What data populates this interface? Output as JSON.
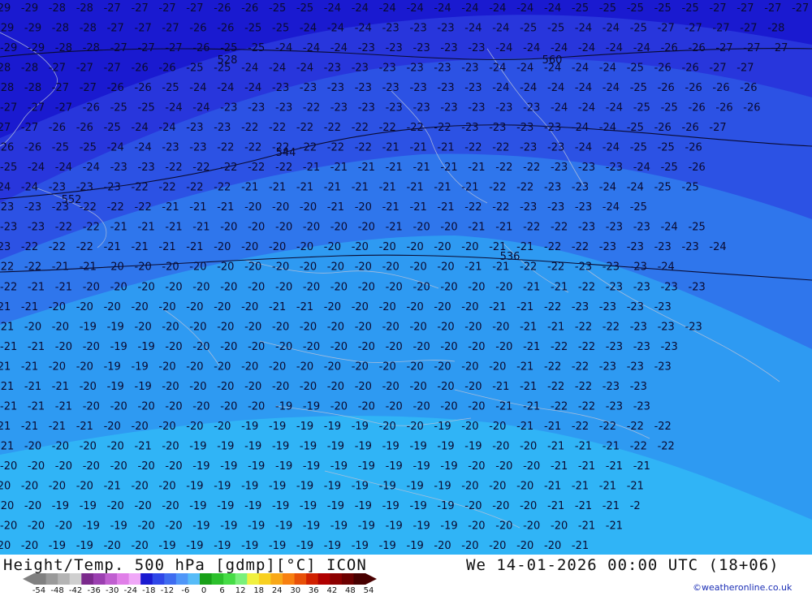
{
  "map": {
    "title": "Height/Temp. 500 hPa [gdmp][°C] ICON",
    "valid_time": "We 14-01-2026 00:00 UTC (18+06)",
    "credit": "©weatheronline.co.uk",
    "height_labels": [
      "560",
      "552",
      "544",
      "536",
      "528"
    ],
    "temperature_rows": [
      {
        "values": [
          29,
          29,
          28,
          28,
          27,
          27,
          27,
          27,
          26,
          26,
          25,
          25,
          24,
          24,
          24,
          24,
          24,
          24,
          24,
          24,
          24,
          25,
          25,
          25,
          25,
          25,
          27,
          27,
          27,
          27,
          28
        ]
      },
      {
        "values": [
          29,
          29,
          28,
          28,
          27,
          27,
          27,
          26,
          26,
          25,
          25,
          24,
          24,
          24,
          23,
          23,
          23,
          24,
          24,
          25,
          25,
          24,
          24,
          25,
          27,
          27,
          27,
          27,
          28
        ]
      },
      {
        "values": [
          29,
          29,
          28,
          28,
          27,
          27,
          27,
          26,
          25,
          25,
          24,
          24,
          24,
          23,
          23,
          23,
          23,
          23,
          24,
          24,
          24,
          24,
          24,
          24,
          26,
          26,
          27,
          27,
          27
        ]
      },
      {
        "values": [
          28,
          28,
          27,
          27,
          27,
          26,
          26,
          25,
          25,
          24,
          24,
          24,
          23,
          23,
          23,
          23,
          23,
          23,
          24,
          24,
          24,
          24,
          24,
          25,
          26,
          26,
          27,
          27
        ]
      },
      {
        "values": [
          28,
          28,
          27,
          27,
          26,
          26,
          25,
          24,
          24,
          24,
          23,
          23,
          23,
          23,
          23,
          23,
          23,
          23,
          24,
          24,
          24,
          24,
          24,
          25,
          26,
          26,
          26,
          26
        ]
      },
      {
        "values": [
          27,
          27,
          27,
          26,
          25,
          25,
          24,
          24,
          23,
          23,
          23,
          22,
          23,
          23,
          23,
          23,
          23,
          23,
          23,
          23,
          24,
          24,
          24,
          25,
          25,
          26,
          26,
          26
        ]
      },
      {
        "values": [
          27,
          27,
          26,
          26,
          25,
          24,
          24,
          23,
          23,
          22,
          22,
          22,
          22,
          22,
          22,
          22,
          22,
          23,
          23,
          23,
          23,
          24,
          24,
          25,
          26,
          26,
          27
        ]
      },
      {
        "values": [
          26,
          26,
          25,
          25,
          24,
          24,
          23,
          23,
          22,
          22,
          22,
          22,
          22,
          22,
          21,
          21,
          21,
          22,
          22,
          23,
          23,
          24,
          24,
          25,
          25,
          26
        ]
      },
      {
        "values": [
          25,
          24,
          24,
          24,
          23,
          23,
          22,
          22,
          22,
          22,
          22,
          21,
          21,
          21,
          21,
          21,
          21,
          21,
          22,
          22,
          23,
          23,
          23,
          24,
          25,
          26
        ]
      },
      {
        "values": [
          24,
          24,
          23,
          23,
          23,
          22,
          22,
          22,
          22,
          21,
          21,
          21,
          21,
          21,
          21,
          21,
          21,
          21,
          22,
          22,
          23,
          23,
          24,
          24,
          25,
          25
        ]
      },
      {
        "values": [
          23,
          23,
          23,
          22,
          22,
          22,
          21,
          21,
          21,
          20,
          20,
          20,
          21,
          20,
          21,
          21,
          21,
          22,
          22,
          23,
          23,
          23,
          24,
          25
        ]
      },
      {
        "values": [
          23,
          23,
          22,
          22,
          21,
          21,
          21,
          21,
          20,
          20,
          20,
          20,
          20,
          20,
          21,
          20,
          20,
          21,
          21,
          22,
          22,
          23,
          23,
          23,
          24,
          25
        ]
      },
      {
        "values": [
          23,
          22,
          22,
          22,
          21,
          21,
          21,
          21,
          20,
          20,
          20,
          20,
          20,
          20,
          20,
          20,
          20,
          20,
          21,
          21,
          22,
          22,
          23,
          23,
          23,
          23,
          24
        ]
      },
      {
        "values": [
          22,
          22,
          21,
          21,
          20,
          20,
          20,
          20,
          20,
          20,
          20,
          20,
          20,
          20,
          20,
          20,
          20,
          21,
          21,
          22,
          22,
          23,
          23,
          23,
          24
        ]
      },
      {
        "values": [
          22,
          21,
          21,
          20,
          20,
          20,
          20,
          20,
          20,
          20,
          20,
          20,
          20,
          20,
          20,
          20,
          20,
          20,
          20,
          21,
          21,
          22,
          23,
          23,
          23,
          23
        ]
      },
      {
        "values": [
          21,
          21,
          20,
          20,
          20,
          20,
          20,
          20,
          20,
          20,
          21,
          21,
          20,
          20,
          20,
          20,
          20,
          20,
          21,
          21,
          22,
          23,
          23,
          23,
          23
        ]
      },
      {
        "values": [
          21,
          20,
          20,
          19,
          19,
          20,
          20,
          20,
          20,
          20,
          20,
          20,
          20,
          20,
          20,
          20,
          20,
          20,
          20,
          21,
          21,
          22,
          22,
          23,
          23,
          23
        ]
      },
      {
        "values": [
          21,
          21,
          20,
          20,
          19,
          19,
          20,
          20,
          20,
          20,
          20,
          20,
          20,
          20,
          20,
          20,
          20,
          20,
          20,
          21,
          22,
          22,
          23,
          23,
          23
        ]
      },
      {
        "values": [
          21,
          21,
          20,
          20,
          19,
          19,
          20,
          20,
          20,
          20,
          20,
          20,
          20,
          20,
          20,
          20,
          20,
          20,
          20,
          21,
          22,
          22,
          23,
          23,
          23
        ]
      },
      {
        "values": [
          21,
          21,
          21,
          20,
          19,
          19,
          20,
          20,
          20,
          20,
          20,
          20,
          20,
          20,
          20,
          20,
          20,
          20,
          21,
          21,
          22,
          22,
          23,
          23
        ]
      },
      {
        "values": [
          21,
          21,
          21,
          20,
          20,
          20,
          20,
          20,
          20,
          20,
          19,
          19,
          20,
          20,
          20,
          20,
          20,
          20,
          21,
          21,
          22,
          22,
          23,
          23
        ]
      },
      {
        "values": [
          21,
          21,
          21,
          21,
          20,
          20,
          20,
          20,
          20,
          19,
          19,
          19,
          19,
          19,
          20,
          20,
          19,
          20,
          20,
          21,
          21,
          22,
          22,
          22,
          22
        ]
      },
      {
        "values": [
          21,
          20,
          20,
          20,
          20,
          21,
          20,
          19,
          19,
          19,
          19,
          19,
          19,
          19,
          19,
          19,
          19,
          19,
          20,
          20,
          21,
          21,
          21,
          22,
          22
        ]
      },
      {
        "values": [
          20,
          20,
          20,
          20,
          20,
          20,
          20,
          19,
          19,
          19,
          19,
          19,
          19,
          19,
          19,
          19,
          19,
          20,
          20,
          20,
          21,
          21,
          21,
          21
        ]
      },
      {
        "values": [
          20,
          20,
          20,
          20,
          21,
          20,
          20,
          19,
          19,
          19,
          19,
          19,
          19,
          19,
          19,
          19,
          19,
          20,
          20,
          20,
          21,
          21,
          21,
          21
        ]
      },
      {
        "values": [
          20,
          20,
          19,
          19,
          20,
          20,
          20,
          19,
          19,
          19,
          19,
          19,
          19,
          19,
          19,
          19,
          19,
          20,
          20,
          20,
          21,
          21,
          21,
          2
        ]
      },
      {
        "values": [
          20,
          20,
          20,
          19,
          19,
          20,
          20,
          19,
          19,
          19,
          19,
          19,
          19,
          19,
          19,
          19,
          19,
          20,
          20,
          20,
          20,
          21,
          21
        ]
      },
      {
        "values": [
          20,
          20,
          19,
          19,
          20,
          20,
          19,
          19,
          19,
          19,
          19,
          19,
          19,
          19,
          19,
          19,
          20,
          20,
          20,
          20,
          20,
          21
        ]
      }
    ]
  },
  "scale": {
    "ticks": [
      "-54",
      "-48",
      "-42",
      "-36",
      "-30",
      "-24",
      "-18",
      "-12",
      "-6",
      "0",
      "6",
      "12",
      "18",
      "24",
      "30",
      "36",
      "42",
      "48",
      "54"
    ],
    "colors": [
      "#808080",
      "#9a9a9a",
      "#b4b4b4",
      "#cfcfcf",
      "#7b2a8c",
      "#9b3fb0",
      "#c05fd0",
      "#e07fe8",
      "#f0a8f8",
      "#1a1ad0",
      "#2f47e8",
      "#3f6cf0",
      "#4f96f8",
      "#57bcf8",
      "#18a018",
      "#2cc02c",
      "#46dc46",
      "#7af07a",
      "#f0f040",
      "#f8d020",
      "#f8a818",
      "#f88010",
      "#e85008",
      "#d02000",
      "#b00000",
      "#8c0000",
      "#6c0000",
      "#480000"
    ]
  }
}
